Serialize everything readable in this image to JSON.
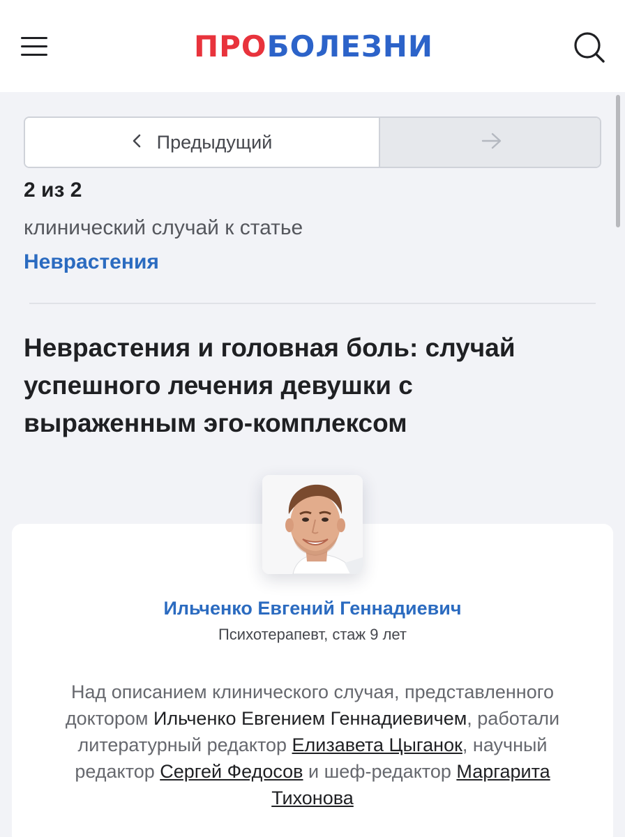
{
  "header": {
    "logo_part_red": "ПРО",
    "logo_part_blue": "БОЛЕЗНИ",
    "icons": {
      "menu": "hamburger-menu-icon",
      "search": "search-icon"
    }
  },
  "navigation": {
    "prev_label": "Предыдущий",
    "prev_icon": "chevron-left-icon",
    "next_icon": "arrow-right-icon",
    "next_enabled": false
  },
  "case": {
    "counter": "2 из 2",
    "subtitle": "клинический случай к статье",
    "article_link": "Неврастения",
    "title": "Неврастения и головная боль: случай успешного лечения девушки с выраженным эго-комплексом"
  },
  "doctor": {
    "name": "Ильченко Евгений Геннадиевич",
    "meta": "Психотерапевт, стаж 9 лет"
  },
  "credits": {
    "intro": "Над описанием клинического случая, представленного доктором ",
    "doctor_name": "Ильченко Евгением Геннадиевичем",
    "mid1": ", работали литературный редактор ",
    "literary_editor": "Елизавета Цыганок",
    "mid2": ", научный редактор ",
    "science_editor": "Сергей Федосов",
    "mid3": " и шеф-редактор ",
    "chief_editor": "Маргарита Тихонова"
  },
  "colors": {
    "brand_red": "#e8333c",
    "brand_blue": "#2c63c9",
    "link_blue": "#2b6bc0",
    "background": "#f2f3f7"
  }
}
